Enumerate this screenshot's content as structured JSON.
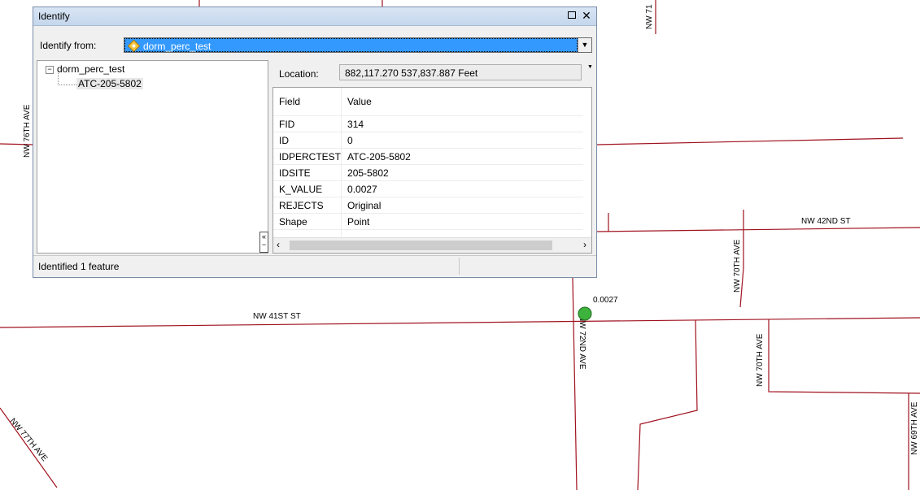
{
  "map": {
    "roads": [
      "NW 71",
      "NW 76TH AVE",
      "NW 42ND ST",
      "NW 70TH AVE",
      "NW 41ST ST",
      "NW 72ND AVE",
      "NW 70TH AVE",
      "NW 69TH AVE",
      "NW 77TH AVE"
    ],
    "point_label": "0.0027",
    "road_color": "#a0121f",
    "point_color": "#3db33d"
  },
  "identify": {
    "title": "Identify",
    "from_label": "Identify from:",
    "from_value": "dorm_perc_test",
    "tree": {
      "root": "dorm_perc_test",
      "child": "ATC-205-5802"
    },
    "location_label": "Location:",
    "location_value": "882,117.270  537,837.887 Feet",
    "columns": [
      "Field",
      "Value"
    ],
    "rows": [
      {
        "field": "FID",
        "value": "314"
      },
      {
        "field": "ID",
        "value": "0"
      },
      {
        "field": "IDPERCTEST",
        "value": "ATC-205-5802"
      },
      {
        "field": "IDSITE",
        "value": "205-5802"
      },
      {
        "field": "K_VALUE",
        "value": "0.0027"
      },
      {
        "field": "REJECTS",
        "value": "Original"
      },
      {
        "field": "Shape",
        "value": "Point"
      }
    ],
    "status": "Identified 1 feature",
    "accent_color": "#3399ff"
  }
}
